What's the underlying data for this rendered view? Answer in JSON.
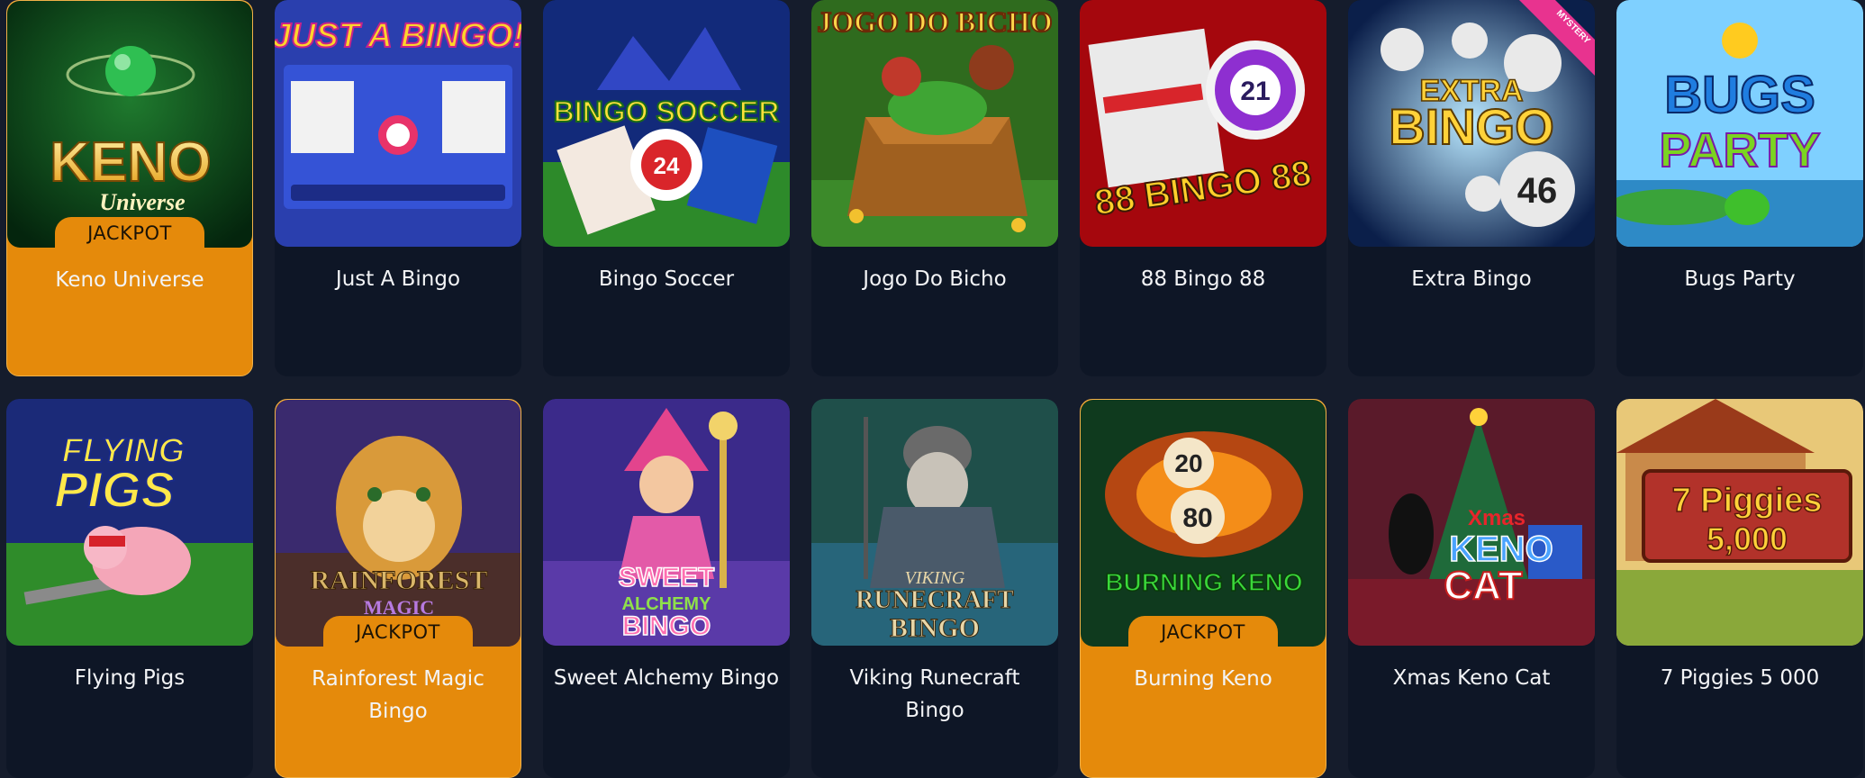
{
  "badge_label": "JACKPOT",
  "colors": {
    "page_bg": "#151c2c",
    "card_bg": "#0e1626",
    "jackpot_bg": "#e58a0b"
  },
  "games": [
    {
      "title": "Keno Universe",
      "jackpot": true,
      "art_text": [
        "KENO",
        "Universe"
      ]
    },
    {
      "title": "Just A Bingo",
      "jackpot": false,
      "art_text": [
        "JUST A BINGO!"
      ]
    },
    {
      "title": "Bingo Soccer",
      "jackpot": false,
      "art_text": [
        "BINGO SOCCER",
        "24"
      ]
    },
    {
      "title": "Jogo Do Bicho",
      "jackpot": false,
      "art_text": [
        "JOGO DO BICHO"
      ]
    },
    {
      "title": "88 Bingo 88",
      "jackpot": false,
      "art_text": [
        "88 BINGO 88",
        "21"
      ]
    },
    {
      "title": "Extra Bingo",
      "jackpot": false,
      "art_text": [
        "EXTRA",
        "BINGO",
        "46",
        "MYSTERY"
      ]
    },
    {
      "title": "Bugs Party",
      "jackpot": false,
      "art_text": [
        "BUGS",
        "PARTY"
      ]
    },
    {
      "title": "Flying Pigs",
      "jackpot": false,
      "art_text": [
        "FLYING",
        "PIGS"
      ]
    },
    {
      "title": "Rainforest Magic Bingo",
      "jackpot": true,
      "art_text": [
        "RAINFOREST",
        "MAGIC"
      ]
    },
    {
      "title": "Sweet Alchemy Bingo",
      "jackpot": false,
      "art_text": [
        "SWEET",
        "ALCHEMY",
        "BINGO"
      ]
    },
    {
      "title": "Viking Runecraft Bingo",
      "jackpot": false,
      "art_text": [
        "VIKING",
        "RUNECRAFT",
        "BINGO"
      ]
    },
    {
      "title": "Burning Keno",
      "jackpot": true,
      "art_text": [
        "BURNING KENO",
        "20",
        "80"
      ]
    },
    {
      "title": "Xmas Keno Cat",
      "jackpot": false,
      "art_text": [
        "Xmas",
        "KENO",
        "CAT"
      ]
    },
    {
      "title": "7 Piggies 5 000",
      "jackpot": false,
      "art_text": [
        "7 Piggies",
        "5,000"
      ]
    }
  ]
}
